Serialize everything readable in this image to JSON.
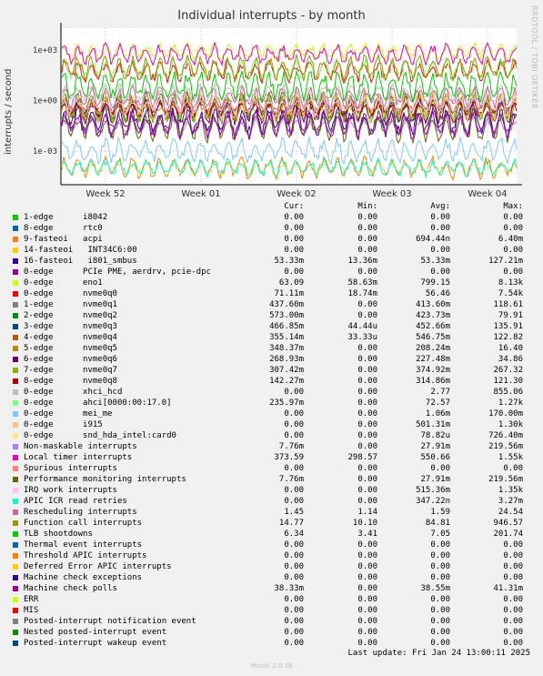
{
  "graph": {
    "title": "Individual interrupts - by month",
    "side_label": "RRDTOOL / TOBI OETIKER",
    "footer": "Munin 2.0.76",
    "last_update": "Last update: Fri Jan 24 13:00:11 2025"
  },
  "chart_data": {
    "type": "line",
    "ylabel": "interrupts / second",
    "yscale": "log",
    "ylim": [
      1e-05,
      20000
    ],
    "y_ticks": [
      "1e+03",
      "1e+00",
      "1e-03"
    ],
    "x_ticks": [
      "Week 52",
      "Week 01",
      "Week 02",
      "Week 03",
      "Week 04"
    ],
    "grid": true,
    "legend_columns": [
      "Cur:",
      "Min:",
      "Avg:",
      "Max:"
    ],
    "series": [
      {
        "name": "1-edge      i8042",
        "color": "#00cc00",
        "cur": "0.00",
        "min": "0.00",
        "avg": "0.00",
        "max": "0.00"
      },
      {
        "name": "8-edge      rtc0",
        "color": "#0066b3",
        "cur": "0.00",
        "min": "0.00",
        "avg": "0.00",
        "max": "0.00"
      },
      {
        "name": "9-fasteoi   acpi",
        "color": "#ff8000",
        "cur": "0.00",
        "min": "0.00",
        "avg": "694.44n",
        "max": "6.40m"
      },
      {
        "name": "14-fasteoi   INT34C6:00",
        "color": "#ffcc00",
        "cur": "0.00",
        "min": "0.00",
        "avg": "0.00",
        "max": "0.00"
      },
      {
        "name": "16-fasteoi   i801_smbus",
        "color": "#330099",
        "cur": "53.33m",
        "min": "13.36m",
        "avg": "53.33m",
        "max": "127.21m"
      },
      {
        "name": "0-edge      PCIe PME, aerdrv, pcie-dpc",
        "color": "#990099",
        "cur": "0.00",
        "min": "0.00",
        "avg": "0.00",
        "max": "0.00"
      },
      {
        "name": "0-edge      eno1",
        "color": "#ccff00",
        "cur": "63.09",
        "min": "58.63m",
        "avg": "799.15",
        "max": "8.13k"
      },
      {
        "name": "0-edge      nvme0q0",
        "color": "#ff0000",
        "cur": "71.11m",
        "min": "18.74m",
        "avg": "56.46",
        "max": "7.54k"
      },
      {
        "name": "1-edge      nvme0q1",
        "color": "#808080",
        "cur": "437.60m",
        "min": "0.00",
        "avg": "413.60m",
        "max": "118.61"
      },
      {
        "name": "2-edge      nvme0q2",
        "color": "#008f00",
        "cur": "573.00m",
        "min": "0.00",
        "avg": "423.73m",
        "max": "79.91"
      },
      {
        "name": "3-edge      nvme0q3",
        "color": "#00487d",
        "cur": "466.85m",
        "min": "44.44u",
        "avg": "452.66m",
        "max": "135.91"
      },
      {
        "name": "4-edge      nvme0q4",
        "color": "#b35a00",
        "cur": "355.14m",
        "min": "33.33u",
        "avg": "546.75m",
        "max": "122.82"
      },
      {
        "name": "5-edge      nvme0q5",
        "color": "#b38f00",
        "cur": "348.37m",
        "min": "0.00",
        "avg": "208.24m",
        "max": "16.40"
      },
      {
        "name": "6-edge      nvme0q6",
        "color": "#6b006b",
        "cur": "268.93m",
        "min": "0.00",
        "avg": "227.48m",
        "max": "34.86"
      },
      {
        "name": "7-edge      nvme0q7",
        "color": "#8fb300",
        "cur": "307.42m",
        "min": "0.00",
        "avg": "374.92m",
        "max": "267.32"
      },
      {
        "name": "8-edge      nvme0q8",
        "color": "#b30000",
        "cur": "142.27m",
        "min": "0.00",
        "avg": "314.86m",
        "max": "121.30"
      },
      {
        "name": "0-edge      xhci_hcd",
        "color": "#bebebe",
        "cur": "0.00",
        "min": "0.00",
        "avg": "2.77",
        "max": "855.06"
      },
      {
        "name": "0-edge      ahci[0000:00:17.0]",
        "color": "#80ff80",
        "cur": "235.97m",
        "min": "0.00",
        "avg": "72.57",
        "max": "1.27k"
      },
      {
        "name": "0-edge      mei_me",
        "color": "#80c9ff",
        "cur": "0.00",
        "min": "0.00",
        "avg": "1.06m",
        "max": "170.00m"
      },
      {
        "name": "0-edge      i915",
        "color": "#ffc080",
        "cur": "0.00",
        "min": "0.00",
        "avg": "501.31m",
        "max": "1.30k"
      },
      {
        "name": "0-edge      snd_hda_intel:card0",
        "color": "#ffe680",
        "cur": "0.00",
        "min": "0.00",
        "avg": "78.82u",
        "max": "726.40m"
      },
      {
        "name": "Non-maskable interrupts",
        "color": "#aa80ff",
        "cur": "7.76m",
        "min": "0.00",
        "avg": "27.91m",
        "max": "219.56m"
      },
      {
        "name": "Local timer interrupts",
        "color": "#ee00cc",
        "cur": "373.59",
        "min": "298.57",
        "avg": "550.66",
        "max": "1.55k"
      },
      {
        "name": "Spurious interrupts",
        "color": "#ff8080",
        "cur": "0.00",
        "min": "0.00",
        "avg": "0.00",
        "max": "0.00"
      },
      {
        "name": "Performance monitoring interrupts",
        "color": "#666600",
        "cur": "7.76m",
        "min": "0.00",
        "avg": "27.91m",
        "max": "219.56m"
      },
      {
        "name": "IRQ work interrupts",
        "color": "#ffbfff",
        "cur": "0.00",
        "min": "0.00",
        "avg": "515.36m",
        "max": "1.35k"
      },
      {
        "name": "APIC ICR read retries",
        "color": "#00ffcc",
        "cur": "0.00",
        "min": "0.00",
        "avg": "347.22n",
        "max": "3.27m"
      },
      {
        "name": "Rescheduling interrupts",
        "color": "#cc6699",
        "cur": "1.45",
        "min": "1.14",
        "avg": "1.59",
        "max": "24.54"
      },
      {
        "name": "Function call interrupts",
        "color": "#999900",
        "cur": "14.77",
        "min": "10.10",
        "avg": "84.81",
        "max": "946.57"
      },
      {
        "name": "TLB shootdowns",
        "color": "#00cc00",
        "cur": "6.34",
        "min": "3.41",
        "avg": "7.05",
        "max": "201.74"
      },
      {
        "name": "Thermal event interrupts",
        "color": "#0066b3",
        "cur": "0.00",
        "min": "0.00",
        "avg": "0.00",
        "max": "0.00"
      },
      {
        "name": "Threshold APIC interrupts",
        "color": "#ff8000",
        "cur": "0.00",
        "min": "0.00",
        "avg": "0.00",
        "max": "0.00"
      },
      {
        "name": "Deferred Error APIC interrupts",
        "color": "#ffcc00",
        "cur": "0.00",
        "min": "0.00",
        "avg": "0.00",
        "max": "0.00"
      },
      {
        "name": "Machine check exceptions",
        "color": "#330099",
        "cur": "0.00",
        "min": "0.00",
        "avg": "0.00",
        "max": "0.00"
      },
      {
        "name": "Machine check polls",
        "color": "#990099",
        "cur": "38.33m",
        "min": "0.00",
        "avg": "38.55m",
        "max": "41.31m"
      },
      {
        "name": "ERR",
        "color": "#ccff00",
        "cur": "0.00",
        "min": "0.00",
        "avg": "0.00",
        "max": "0.00"
      },
      {
        "name": "MIS",
        "color": "#ff0000",
        "cur": "0.00",
        "min": "0.00",
        "avg": "0.00",
        "max": "0.00"
      },
      {
        "name": "Posted-interrupt notification event",
        "color": "#808080",
        "cur": "0.00",
        "min": "0.00",
        "avg": "0.00",
        "max": "0.00"
      },
      {
        "name": "Nested posted-interrupt event",
        "color": "#008f00",
        "cur": "0.00",
        "min": "0.00",
        "avg": "0.00",
        "max": "0.00"
      },
      {
        "name": "Posted-interrupt wakeup event",
        "color": "#00487d",
        "cur": "0.00",
        "min": "0.00",
        "avg": "0.00",
        "max": "0.00"
      }
    ]
  }
}
